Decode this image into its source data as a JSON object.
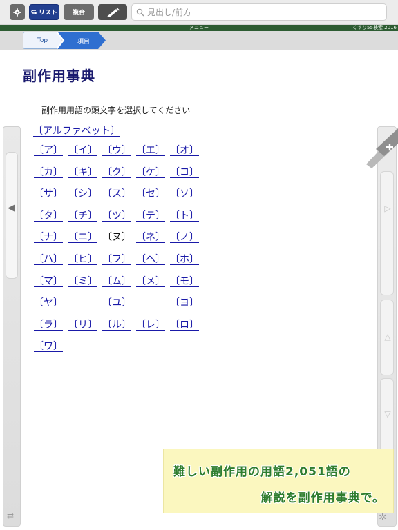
{
  "toolbar": {
    "list_label": "リスト",
    "multi_label": "複合",
    "search_placeholder": "見出し/前方"
  },
  "statusbar": {
    "menu_label": "メニュー",
    "brand": "くすり55検索 2016"
  },
  "breadcrumb": {
    "top_label": "Top",
    "current_label": "項目"
  },
  "page": {
    "title": "副作用事典",
    "instruction": "副作用用語の頭文字を選択してください"
  },
  "kana_index": {
    "alphabet": "〔アルファベット〕",
    "rows": [
      [
        "〔ア〕",
        "〔イ〕",
        "〔ウ〕",
        "〔エ〕",
        "〔オ〕"
      ],
      [
        "〔カ〕",
        "〔キ〕",
        "〔ク〕",
        "〔ケ〕",
        "〔コ〕"
      ],
      [
        "〔サ〕",
        "〔シ〕",
        "〔ス〕",
        "〔セ〕",
        "〔ソ〕"
      ],
      [
        "〔タ〕",
        "〔チ〕",
        "〔ツ〕",
        "〔テ〕",
        "〔ト〕"
      ],
      [
        "〔ナ〕",
        "〔ニ〕",
        "〔ヌ〕",
        "〔ネ〕",
        "〔ノ〕"
      ],
      [
        "〔ハ〕",
        "〔ヒ〕",
        "〔フ〕",
        "〔ヘ〕",
        "〔ホ〕"
      ],
      [
        "〔マ〕",
        "〔ミ〕",
        "〔ム〕",
        "〔メ〕",
        "〔モ〕"
      ],
      [
        "〔ヤ〕",
        "",
        "〔ユ〕",
        "",
        "〔ヨ〕"
      ],
      [
        "〔ラ〕",
        "〔リ〕",
        "〔ル〕",
        "〔レ〕",
        "〔ロ〕"
      ],
      [
        "〔ワ〕",
        "",
        "",
        "",
        ""
      ]
    ],
    "disabled": [
      "〔ヌ〕"
    ]
  },
  "promo": {
    "line1": "難しい副作用の用語2,051語の",
    "line2": "解説を副作用事典で。"
  },
  "icons": {
    "gear": "gear-icon",
    "list": "list-icon",
    "pen": "pen-icon",
    "search": "search-icon",
    "left_arrow": "chevron-left-icon",
    "plus": "plus-icon",
    "play": "play-icon",
    "up": "triangle-up-icon",
    "down": "triangle-down-icon",
    "swap": "swap-icon"
  },
  "colors": {
    "link": "#1a1aa8",
    "title": "#1a1a6e",
    "statusbar": "#2d5c32",
    "breadcrumb_active": "#2f6fd0",
    "promo_bg": "#fbf7bf",
    "promo_text": "#2e7d2e"
  }
}
